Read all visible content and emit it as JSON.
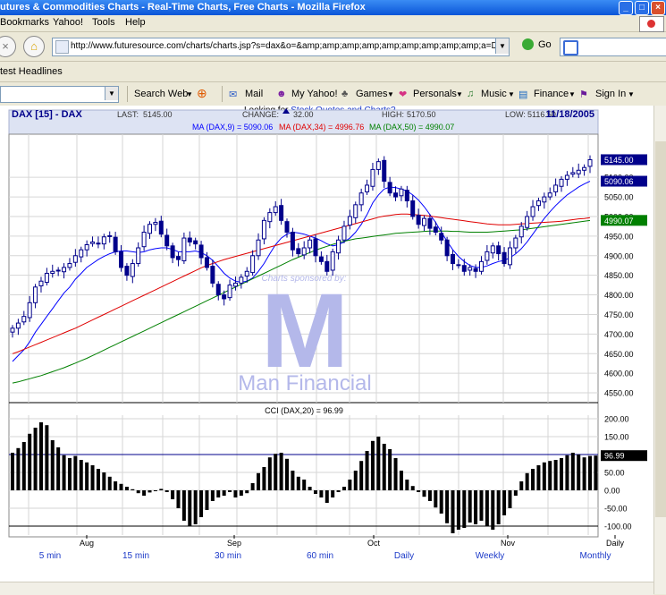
{
  "window": {
    "title": "utures & Commodities Charts - Real-Time Charts, Free Charts - Mozilla Firefox",
    "min": "_",
    "max": "□",
    "close": "×"
  },
  "menu": {
    "bookmarks": "Bookmarks",
    "yahoo": "Yahoo!",
    "tools": "Tools",
    "help": "Help"
  },
  "nav": {
    "url": "http://www.futuresource.com/charts/charts.jsp?s=dax&o=&amp;amp;amp;amp;amp;amp;amp;amp;amp;a=D",
    "go": "Go"
  },
  "bookmarks_bar": {
    "headlines": "test Headlines"
  },
  "yahoo_toolbar": {
    "search_web": "Search Web",
    "mail": "Mail",
    "my_yahoo": "My Yahoo!",
    "games": "Games",
    "personals": "Personals",
    "music": "Music",
    "finance": "Finance",
    "sign_in": "Sign In"
  },
  "page": {
    "looking_prefix": "Looking for",
    "looking_link": "Stock Quotes and Charts?"
  },
  "colors": {
    "ma9": "#0000ff",
    "ma34": "#e00000",
    "ma50": "#008000",
    "price_bar": "#00008b",
    "header_bg": "#dde3f3",
    "label_bg": "#00008b",
    "ma50_label_bg": "#008000",
    "cci_label_bg": "#000000",
    "sponsor": "#b4b8ea"
  },
  "chart_data": {
    "type": "candlestick",
    "header": {
      "symbol": "DAX [15] - DAX",
      "last_label": "LAST:",
      "last": "5145.00",
      "change_label": "CHANGE:",
      "change": "32.00",
      "high_label": "HIGH:",
      "high": "5170.50",
      "low_label": "LOW:",
      "low": "5116.50",
      "date": "11/18/2005"
    },
    "ma_legend": {
      "ma9": "MA (DAX,9) = 5090.06",
      "ma34": "MA (DAX,34) = 4996.76",
      "ma50": "MA (DAX,50) = 4990.07"
    },
    "price_axis": {
      "ylim": [
        4525,
        5210
      ],
      "ticks": [
        4550,
        4600,
        4650,
        4700,
        4750,
        4800,
        4850,
        4900,
        4950,
        5000,
        5050,
        5100
      ]
    },
    "price_tick_labels": [
      "4550.00",
      "4600.00",
      "4650.00",
      "4700.00",
      "4750.00",
      "4800.00",
      "4850.00",
      "4900.00",
      "4950.00",
      "5000.00",
      "5050.00",
      "5100.00"
    ],
    "value_labels": {
      "last": "5145.00",
      "ma9": "5090.06",
      "ma50": "4990.07"
    },
    "closes": [
      4715,
      4728,
      4745,
      4780,
      4820,
      4835,
      4855,
      4860,
      4862,
      4870,
      4880,
      4900,
      4915,
      4928,
      4935,
      4930,
      4948,
      4950,
      4910,
      4870,
      4850,
      4880,
      4920,
      4960,
      4980,
      4985,
      4955,
      4925,
      4895,
      4890,
      4945,
      4935,
      4930,
      4895,
      4870,
      4830,
      4800,
      4790,
      4825,
      4830,
      4845,
      4860,
      4900,
      4940,
      4990,
      5010,
      5025,
      4990,
      4960,
      4915,
      4905,
      4920,
      4940,
      4900,
      4885,
      4860,
      4910,
      4940,
      4975,
      5000,
      5030,
      5060,
      5080,
      5120,
      5140,
      5090,
      5060,
      5050,
      5070,
      5040,
      5000,
      4980,
      4995,
      4970,
      4960,
      4940,
      4900,
      4880,
      4875,
      4860,
      4870,
      4860,
      4885,
      4910,
      4925,
      4905,
      4880,
      4920,
      4945,
      4975,
      5000,
      5025,
      5040,
      5050,
      5060,
      5080,
      5095,
      5105,
      5112,
      5118,
      5125,
      5145
    ],
    "ma_series": [
      {
        "name": "MA (DAX,9)",
        "values": [
          4630,
          4645,
          4660,
          4680,
          4705,
          4725,
          4745,
          4765,
          4785,
          4805,
          4820,
          4840,
          4855,
          4870,
          4880,
          4890,
          4898,
          4905,
          4910,
          4912,
          4912,
          4910,
          4908,
          4910,
          4915,
          4918,
          4920,
          4920,
          4916,
          4910,
          4910,
          4910,
          4912,
          4908,
          4900,
          4888,
          4872,
          4855,
          4843,
          4835,
          4832,
          4835,
          4843,
          4860,
          4880,
          4905,
          4928,
          4945,
          4955,
          4960,
          4958,
          4955,
          4950,
          4945,
          4938,
          4930,
          4925,
          4928,
          4935,
          4945,
          4960,
          4980,
          5005,
          5035,
          5055,
          5070,
          5075,
          5074,
          5070,
          5065,
          5055,
          5042,
          5025,
          5005,
          4985,
          4960,
          4937,
          4915,
          4898,
          4885,
          4875,
          4870,
          4870,
          4874,
          4880,
          4885,
          4888,
          4895,
          4905,
          4918,
          4935,
          4955,
          4975,
          4995,
          5012,
          5028,
          5042,
          5055,
          5065,
          5075,
          5083,
          5090
        ]
      },
      {
        "name": "MA (DAX,34)",
        "values": [
          4650,
          4655,
          4661,
          4667,
          4673,
          4679,
          4685,
          4691,
          4697,
          4703,
          4709,
          4715,
          4722,
          4729,
          4736,
          4743,
          4750,
          4757,
          4764,
          4771,
          4778,
          4785,
          4792,
          4799,
          4806,
          4813,
          4820,
          4827,
          4834,
          4841,
          4848,
          4855,
          4862,
          4869,
          4875,
          4880,
          4885,
          4890,
          4894,
          4898,
          4902,
          4906,
          4910,
          4914,
          4918,
          4922,
          4926,
          4930,
          4934,
          4938,
          4942,
          4946,
          4950,
          4954,
          4958,
          4962,
          4966,
          4970,
          4974,
          4978,
          4982,
          4986,
          4990,
          4994,
          4998,
          5001,
          5003,
          5005,
          5006,
          5006,
          5005,
          5004,
          5003,
          5001,
          4999,
          4997,
          4995,
          4993,
          4991,
          4989,
          4987,
          4985,
          4983,
          4981,
          4980,
          4979,
          4979,
          4979,
          4980,
          4981,
          4982,
          4983,
          4984,
          4985,
          4986,
          4987,
          4988,
          4990,
          4992,
          4994,
          4995,
          4997
        ]
      },
      {
        "name": "MA (DAX,50)",
        "values": [
          4575,
          4578,
          4582,
          4586,
          4590,
          4594,
          4599,
          4604,
          4609,
          4614,
          4620,
          4626,
          4632,
          4638,
          4645,
          4652,
          4659,
          4666,
          4673,
          4680,
          4687,
          4694,
          4701,
          4708,
          4715,
          4722,
          4729,
          4736,
          4743,
          4750,
          4757,
          4764,
          4771,
          4778,
          4785,
          4792,
          4799,
          4806,
          4813,
          4820,
          4827,
          4834,
          4841,
          4848,
          4855,
          4862,
          4869,
          4876,
          4883,
          4890,
          4896,
          4902,
          4908,
          4914,
          4919,
          4924,
          4929,
          4933,
          4937,
          4940,
          4943,
          4945,
          4947,
          4949,
          4951,
          4953,
          4955,
          4957,
          4958,
          4959,
          4960,
          4961,
          4962,
          4963,
          4963,
          4963,
          4963,
          4962,
          4962,
          4961,
          4960,
          4960,
          4960,
          4960,
          4961,
          4962,
          4963,
          4964,
          4965,
          4966,
          4968,
          4970,
          4972,
          4974,
          4976,
          4978,
          4980,
          4982,
          4984,
          4986,
          4988,
          4990
        ]
      }
    ],
    "cci": {
      "legend": "CCI (DAX,20) = 96.99",
      "ylim": [
        -125,
        210
      ],
      "ticks": [
        200,
        150,
        100,
        50,
        0,
        -50,
        -100
      ],
      "tick_labels": [
        "200.00",
        "150.00",
        "100.00",
        "50.00",
        "0.00",
        "-50.00",
        "-100.00"
      ],
      "value_label": "96.99",
      "values": [
        105,
        118,
        135,
        158,
        175,
        190,
        182,
        140,
        120,
        98,
        90,
        96,
        85,
        78,
        70,
        60,
        50,
        38,
        25,
        18,
        10,
        3,
        -8,
        -15,
        -6,
        -2,
        4,
        -5,
        -25,
        -50,
        -85,
        -100,
        -95,
        -75,
        -55,
        -30,
        -20,
        -15,
        -5,
        -20,
        -15,
        -8,
        20,
        48,
        65,
        92,
        102,
        105,
        88,
        55,
        38,
        30,
        10,
        -10,
        -20,
        -35,
        -20,
        -5,
        10,
        30,
        55,
        82,
        110,
        138,
        150,
        130,
        115,
        90,
        55,
        30,
        12,
        -5,
        -18,
        -30,
        -48,
        -65,
        -92,
        -120,
        -110,
        -105,
        -90,
        -95,
        -85,
        -100,
        -110,
        -95,
        -70,
        -50,
        -15,
        25,
        48,
        60,
        70,
        78,
        82,
        85,
        90,
        98,
        105,
        100,
        92,
        96,
        97
      ]
    },
    "x_axis": {
      "labels": [
        "Aug",
        "Sep",
        "Oct",
        "Nov",
        "Daily"
      ]
    },
    "timeframes": [
      "5 min",
      "15 min",
      "30 min",
      "60 min",
      "Daily",
      "Weekly",
      "Monthly"
    ],
    "sponsor": {
      "caption": "Charts sponsored by:",
      "name": "Man Financial",
      "logo": "M"
    }
  }
}
